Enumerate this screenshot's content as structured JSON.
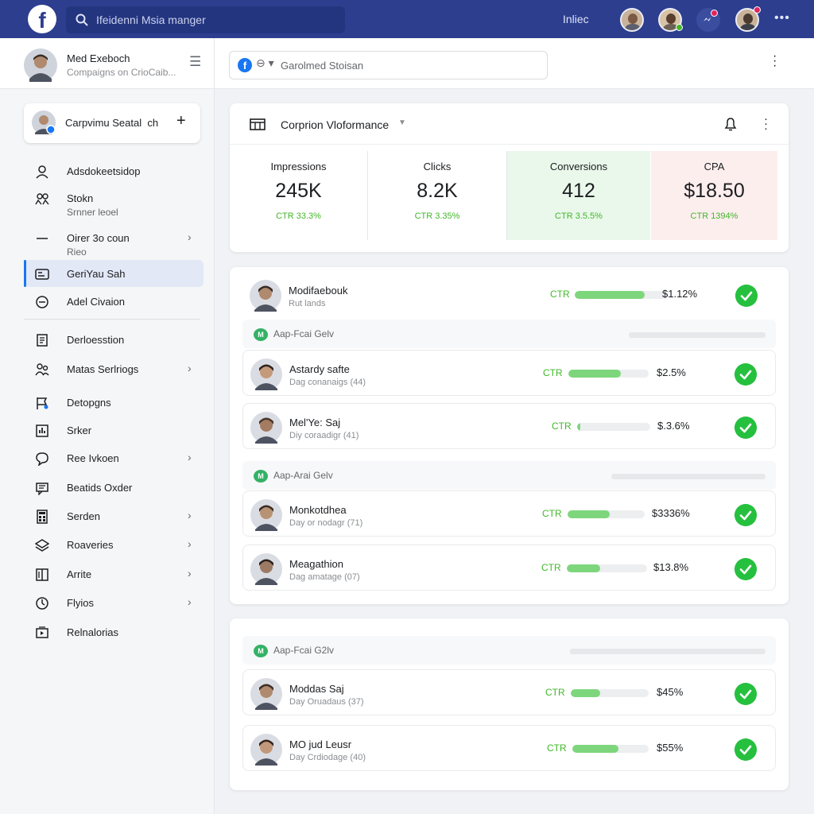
{
  "topbar": {
    "logo_letter": "f",
    "search_placeholder": "Ifeidenni Msia manger",
    "link": "Inliec",
    "more_icon": "more-dots-icon"
  },
  "left_header": {
    "name": "Med Exeboch",
    "subtitle": "Compaigns on CrioCaib..."
  },
  "account_card": {
    "label": "Carpvimu Seatal  ch"
  },
  "sidebar": {
    "items": [
      {
        "label": "Adsdokeetsidop",
        "icon": "person-icon"
      },
      {
        "label": "Stokn",
        "sub": "Srnner leoel",
        "icon": "people-icon"
      },
      {
        "label": "Oirer 3o coun",
        "sub": "Rieo",
        "icon": "minus-icon"
      },
      {
        "label": "GeriYau Sah",
        "icon": "ad-icon"
      },
      {
        "label": "Adel Civaion",
        "icon": "circle-minus-icon"
      },
      {
        "label": "Derloesstion",
        "icon": "document-icon"
      },
      {
        "label": "Matas Serlriogs",
        "icon": "users-icon"
      },
      {
        "label": "Detopgns",
        "icon": "flag-icon"
      },
      {
        "label": "Srker",
        "icon": "chart-icon"
      },
      {
        "label": "Ree Ivkoen",
        "icon": "chat-bubble-icon"
      },
      {
        "label": "Beatids Oxder",
        "icon": "message-icon"
      },
      {
        "label": "Serden",
        "icon": "calculator-icon"
      },
      {
        "label": "Roaveries",
        "icon": "layers-icon"
      },
      {
        "label": "Arrite",
        "icon": "book-icon"
      },
      {
        "label": "Flyios",
        "icon": "clock-icon"
      },
      {
        "label": "Relnalorias",
        "icon": "video-icon"
      }
    ]
  },
  "main_top": {
    "account_value": "Garolmed Stoisan"
  },
  "performance": {
    "title": "Corprion Vloformance",
    "metrics": [
      {
        "label": "Impressions",
        "value": "245K",
        "ctr": "CTR 33.3%"
      },
      {
        "label": "Clicks",
        "value": "8.2K",
        "ctr": "CTR 3.35%"
      },
      {
        "label": "Conversions",
        "value": "412",
        "ctr": "CTR 3.5.5%"
      },
      {
        "label": "CPA",
        "value": "$18.50",
        "ctr": "CTR 1394%"
      }
    ],
    "colors": {
      "conversions_bg": "#e9f8ea",
      "cpa_bg": "#fdeeee",
      "ctr_green": "#42b72a"
    }
  },
  "panel1": {
    "top_row": {
      "name": "Modifaebouk",
      "sub": "Rut lands",
      "ctr": "CTR",
      "amount": "$1.12%",
      "fill": 0.75
    },
    "groups": [
      {
        "badge": "M",
        "label": "Aap-Fcai Gelv",
        "rows": [
          {
            "name": "Astardy safte",
            "sub": "Dag conanaigs (44)",
            "ctr": "CTR",
            "amount": "$2.5%",
            "fill": 0.65
          },
          {
            "name": "Mel'Ye: Saj",
            "sub": "Diy coraadigr (41)",
            "ctr": "CTR",
            "amount": "$.3.6%",
            "fill": 0.04
          }
        ]
      },
      {
        "badge": "M",
        "label": "Aap-Arai Gelv",
        "rows": [
          {
            "name": "Monkotdhea",
            "sub": "Day or nodagr (71)",
            "ctr": "CTR",
            "amount": "$3336%",
            "fill": 0.55
          },
          {
            "name": "Meagathion",
            "sub": "Dag amatage (07)",
            "ctr": "CTR",
            "amount": "$13.8%",
            "fill": 0.42
          }
        ]
      }
    ]
  },
  "panel2": {
    "group": {
      "badge": "M",
      "label": "Aap-Fcai G2lv",
      "rows": [
        {
          "name": "Moddas Saj",
          "sub": "Day Oruadaus (37)",
          "ctr": "CTR",
          "amount": "$45%",
          "fill": 0.38
        },
        {
          "name": "MO jud Leusr",
          "sub": "Day Crdiodage (40)",
          "ctr": "CTR",
          "amount": "$55%",
          "fill": 0.6
        }
      ]
    }
  }
}
